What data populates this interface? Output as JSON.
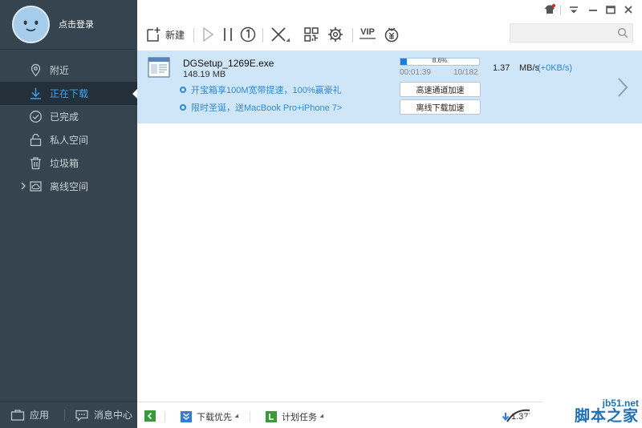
{
  "sidebar": {
    "login_label": "点击登录",
    "items": [
      {
        "label": "附近",
        "icon": "location-pin-icon"
      },
      {
        "label": "正在下载",
        "icon": "download-arrow-icon",
        "active": true
      },
      {
        "label": "已完成",
        "icon": "check-circle-icon"
      },
      {
        "label": "私人空间",
        "icon": "lock-icon"
      },
      {
        "label": "垃圾箱",
        "icon": "trash-icon"
      },
      {
        "label": "离线空间",
        "icon": "cloud-box-icon",
        "expandable": true
      }
    ],
    "bottom": {
      "apps_label": "应用",
      "messages_label": "消息中心"
    }
  },
  "toolbar": {
    "new_label": "新建",
    "tools": [
      "new-task-icon",
      "start-icon",
      "pause-icon",
      "speed-limit-icon",
      "delete-icon",
      "qrcode-icon",
      "settings-gear-icon",
      "vip-icon",
      "gift-icon"
    ],
    "vip_label": "VIP",
    "search_placeholder": ""
  },
  "task": {
    "filename": "DGSetup_1269E.exe",
    "size": "148.19 MB",
    "progress_percent": 8.6,
    "progress_label": "8.6%",
    "elapsed": "00:01:39",
    "pieces": "10/182",
    "speed_value": "1.37",
    "speed_unit": "MB/s",
    "upload_speed": "(+0KB/s)",
    "promo1": "开宝箱享100M宽带提速，100%赢豪礼",
    "promo2": "限时圣诞，送MacBook Pro+iPhone 7>",
    "button1": "高速通道加速",
    "button2": "离线下载加速"
  },
  "statusbar": {
    "download_priority": "下载优先",
    "scheduled_tasks": "计划任务",
    "speed": "1.37M"
  },
  "watermark": {
    "domain": "jb51.net",
    "name": "脚本之家"
  },
  "colors": {
    "sidebar_bg": "#35444e",
    "sidebar_active_bg": "#243039",
    "accent_blue": "#2e88d6",
    "task_row_bg": "#cfe6f8",
    "progress_fill": "#1d7ee2"
  }
}
